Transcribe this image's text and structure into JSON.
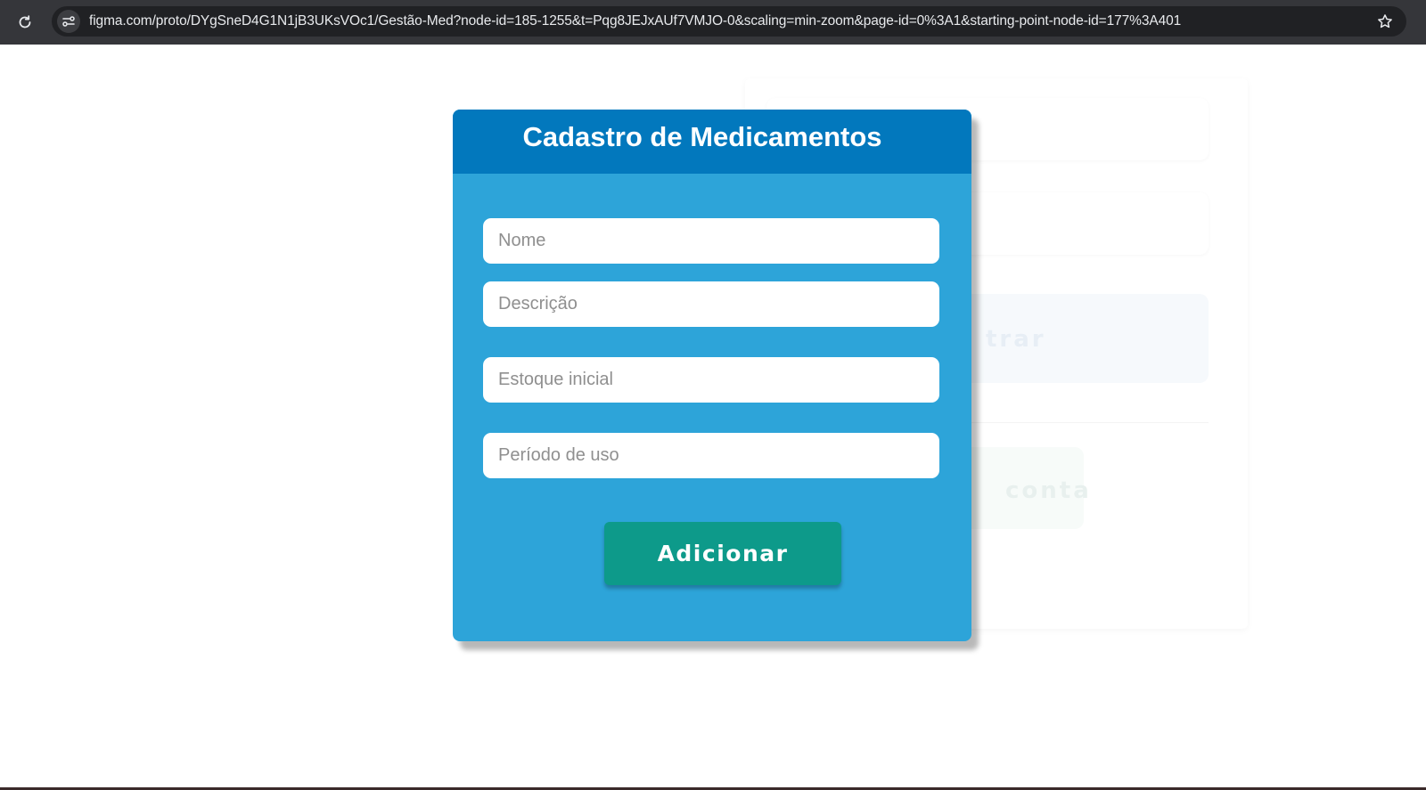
{
  "browser": {
    "url": "figma.com/proto/DYgSneD4G1N1jB3UKsVOc1/Gestão-Med?node-id=185-1255&t=Pqg8JEJxAUf7VMJO-0&scaling=min-zoom&page-id=0%3A1&starting-point-node-id=177%3A401",
    "icons": [
      "reload-icon",
      "site-info-icon",
      "bookmark-star-icon"
    ]
  },
  "background_screen": {
    "login_button_fragment": "trar",
    "create_account_fragment": "conta"
  },
  "modal": {
    "title": "Cadastro de Medicamentos",
    "fields": {
      "name_placeholder": "Nome",
      "description_placeholder": "Descrição",
      "stock_placeholder": "Estoque inicial",
      "period_placeholder": "Período de uso"
    },
    "add_button_label": "Adicionar"
  },
  "colors": {
    "modal_body": "#2da4d9",
    "modal_header": "#0278bd",
    "add_button": "#0d9a8a",
    "browser_bar": "#35363a"
  }
}
